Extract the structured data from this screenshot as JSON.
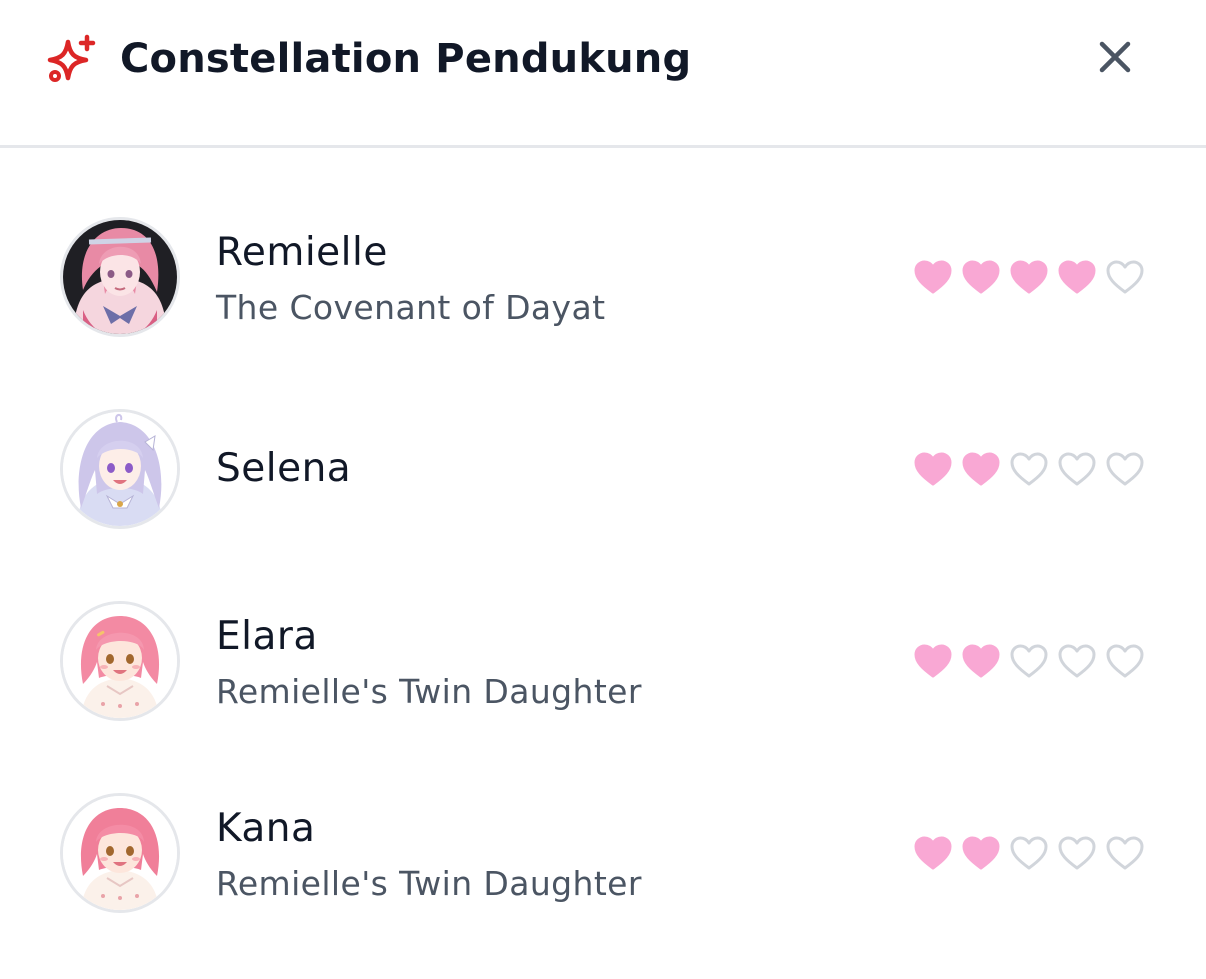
{
  "dialog": {
    "title": "Constellation Pendukung",
    "icon": "sparkles-icon",
    "close_icon": "close-icon"
  },
  "colors": {
    "accent": "#dc2626",
    "heart_filled": "#f9a8d4",
    "heart_empty_stroke": "#d1d5db",
    "title": "#111827",
    "subtitle": "#4b5563"
  },
  "supporters": [
    {
      "name": "Remielle",
      "subtitle": "The Covenant of Dayat",
      "affection": 4,
      "max": 5,
      "avatar": "pink-haired-character-avatar"
    },
    {
      "name": "Selena",
      "subtitle": "",
      "affection": 2,
      "max": 5,
      "avatar": "lavender-haired-character-avatar"
    },
    {
      "name": "Elara",
      "subtitle": "Remielle's Twin Daughter",
      "affection": 2,
      "max": 5,
      "avatar": "pink-haired-child-avatar"
    },
    {
      "name": "Kana",
      "subtitle": "Remielle's Twin Daughter",
      "affection": 2,
      "max": 5,
      "avatar": "pink-haired-child-avatar"
    }
  ]
}
